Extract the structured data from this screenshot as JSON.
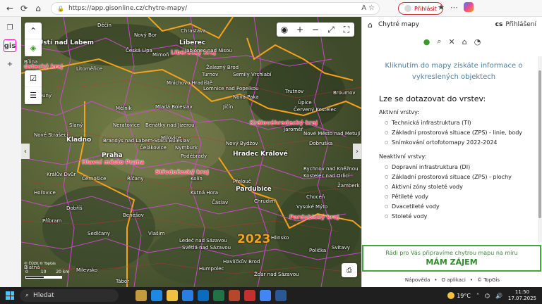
{
  "browser": {
    "url": "https://app.gisonline.cz/chytre-mapy/",
    "login_label": "Přihlásit"
  },
  "sidebar": {
    "gis_tab": "gis"
  },
  "map": {
    "year": "2023",
    "scale_labels": [
      "0",
      "10",
      "20 km"
    ],
    "attribution": "© ČÚZK © TopGis",
    "labels": [
      {
        "text": "Děčín",
        "cls": ""
      },
      {
        "text": "Ústí nad Labem",
        "cls": "big"
      },
      {
        "text": "Nový Bor",
        "cls": ""
      },
      {
        "text": "Chrastava",
        "cls": ""
      },
      {
        "text": "Liberec",
        "cls": "big"
      },
      {
        "text": "Liberecký kraj",
        "cls": "region"
      },
      {
        "text": "Jablonec nad Nisou",
        "cls": ""
      },
      {
        "text": "Česká Lípa",
        "cls": ""
      },
      {
        "text": "Mimoň",
        "cls": ""
      },
      {
        "text": "Bílina",
        "cls": ""
      },
      {
        "text": "ústecký kraj",
        "cls": "region"
      },
      {
        "text": "Litoměřice",
        "cls": ""
      },
      {
        "text": "Železný Brod",
        "cls": ""
      },
      {
        "text": "Turnov",
        "cls": ""
      },
      {
        "text": "Semily",
        "cls": ""
      },
      {
        "text": "Vrchlabí",
        "cls": ""
      },
      {
        "text": "Mnichovo Hradiště",
        "cls": ""
      },
      {
        "text": "Lomnice nad Popelkou",
        "cls": ""
      },
      {
        "text": "Trutnov",
        "cls": ""
      },
      {
        "text": "Broumov",
        "cls": ""
      },
      {
        "text": "Louny",
        "cls": ""
      },
      {
        "text": "Mělník",
        "cls": ""
      },
      {
        "text": "Mladá Boleslav",
        "cls": ""
      },
      {
        "text": "Nová Paka",
        "cls": ""
      },
      {
        "text": "Jičín",
        "cls": ""
      },
      {
        "text": "Úpice",
        "cls": ""
      },
      {
        "text": "Červený Kostelec",
        "cls": ""
      },
      {
        "text": "Slaný",
        "cls": ""
      },
      {
        "text": "Neratovice",
        "cls": ""
      },
      {
        "text": "Benátky nad Jizerou",
        "cls": ""
      },
      {
        "text": "Královéhradecký kraj",
        "cls": "region"
      },
      {
        "text": "Jaroměř",
        "cls": ""
      },
      {
        "text": "Nové Město nad Metují",
        "cls": ""
      },
      {
        "text": "Nové Strašecí",
        "cls": ""
      },
      {
        "text": "Kladno",
        "cls": "big"
      },
      {
        "text": "Brandýs nad Labem-Stará Boleslav",
        "cls": ""
      },
      {
        "text": "Milovice",
        "cls": ""
      },
      {
        "text": "Čelákovice",
        "cls": ""
      },
      {
        "text": "Nový Bydžov",
        "cls": ""
      },
      {
        "text": "Dobruška",
        "cls": ""
      },
      {
        "text": "Nymburk",
        "cls": ""
      },
      {
        "text": "Praha",
        "cls": "big"
      },
      {
        "text": "Hlavní město Praha",
        "cls": "region"
      },
      {
        "text": "Poděbrady",
        "cls": ""
      },
      {
        "text": "Hradec Králové",
        "cls": "big"
      },
      {
        "text": "Rychnov nad Kněžnou",
        "cls": ""
      },
      {
        "text": "Kostelec nad Orlicí",
        "cls": ""
      },
      {
        "text": "Králův Dvůr",
        "cls": ""
      },
      {
        "text": "Černošice",
        "cls": ""
      },
      {
        "text": "Říčany",
        "cls": ""
      },
      {
        "text": "Středočeský kraj",
        "cls": "region"
      },
      {
        "text": "Kolín",
        "cls": ""
      },
      {
        "text": "Přelouč",
        "cls": ""
      },
      {
        "text": "Pardubice",
        "cls": "big"
      },
      {
        "text": "Žamberk",
        "cls": ""
      },
      {
        "text": "Hořovice",
        "cls": ""
      },
      {
        "text": "Kutná Hora",
        "cls": ""
      },
      {
        "text": "Čáslav",
        "cls": ""
      },
      {
        "text": "Chrudim",
        "cls": ""
      },
      {
        "text": "Choceň",
        "cls": ""
      },
      {
        "text": "Vysoké Mýto",
        "cls": ""
      },
      {
        "text": "Dobříš",
        "cls": ""
      },
      {
        "text": "Benešov",
        "cls": ""
      },
      {
        "text": "Pardubický kraj",
        "cls": "region"
      },
      {
        "text": "Příbram",
        "cls": ""
      },
      {
        "text": "Sedlčany",
        "cls": ""
      },
      {
        "text": "Vlašim",
        "cls": ""
      },
      {
        "text": "Ledeč nad Sázavou",
        "cls": ""
      },
      {
        "text": "Světlá nad Sázavou",
        "cls": ""
      },
      {
        "text": "Hlinsko",
        "cls": ""
      },
      {
        "text": "Polička",
        "cls": ""
      },
      {
        "text": "Svitavy",
        "cls": ""
      },
      {
        "text": "Humpolec",
        "cls": ""
      },
      {
        "text": "Havlíčkův Brod",
        "cls": ""
      },
      {
        "text": "Žďár nad Sázavou",
        "cls": ""
      },
      {
        "text": "Blatná",
        "cls": ""
      },
      {
        "text": "Milevsko",
        "cls": ""
      },
      {
        "text": "Tábor",
        "cls": ""
      }
    ]
  },
  "panel": {
    "title": "Chytré mapy",
    "lang": "cs",
    "login": "Přihlášení",
    "intro": "Kliknutím do mapy získáte informace o vykreslených objektech",
    "query_heading": "Lze se dotazovat do vrstev:",
    "active_title": "Aktivní vrstvy:",
    "active_layers": [
      "Technická infrastruktura (TI)",
      "Základní prostorová situace (ZPS) - linie, body",
      "Snímkování ortofotomapy 2022-2024"
    ],
    "inactive_title": "Neaktivní vrstvy:",
    "inactive_layers": [
      "Dopravní infrastruktura (DI)",
      "Základní prostorová situace (ZPS) - plochy",
      "Aktivní zóny stoleté vody",
      "Pětileté vody",
      "Dvacetileté vody",
      "Stoleté vody"
    ],
    "promo_line": "Rádi pro Vás připravíme chytrou mapu na míru",
    "promo_cta": "MÁM ZÁJEM",
    "footer": [
      "Nápověda",
      "•",
      "O aplikaci",
      "•",
      "© TopGis"
    ]
  },
  "taskbar": {
    "search_placeholder": "Hledat",
    "temperature": "19°C",
    "time": "11:50",
    "date": "17.07.2025"
  }
}
